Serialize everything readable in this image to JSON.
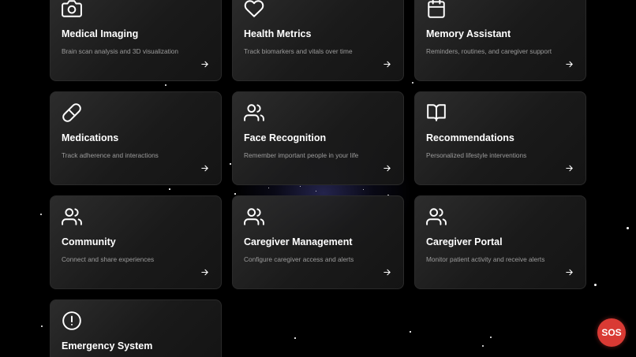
{
  "cards": [
    {
      "title": "Medical Imaging",
      "desc": "Brain scan analysis and 3D visualization",
      "icon": "camera-icon"
    },
    {
      "title": "Health Metrics",
      "desc": "Track biomarkers and vitals over time",
      "icon": "heart-icon"
    },
    {
      "title": "Memory Assistant",
      "desc": "Reminders, routines, and caregiver support",
      "icon": "calendar-icon"
    },
    {
      "title": "Medications",
      "desc": "Track adherence and interactions",
      "icon": "pill-icon"
    },
    {
      "title": "Face Recognition",
      "desc": "Remember important people in your life",
      "icon": "users-icon"
    },
    {
      "title": "Recommendations",
      "desc": "Personalized lifestyle interventions",
      "icon": "book-open-icon"
    },
    {
      "title": "Community",
      "desc": "Connect and share experiences",
      "icon": "users-icon"
    },
    {
      "title": "Caregiver Management",
      "desc": "Configure caregiver access and alerts",
      "icon": "users-icon"
    },
    {
      "title": "Caregiver Portal",
      "desc": "Monitor patient activity and receive alerts",
      "icon": "users-icon"
    },
    {
      "title": "Emergency System",
      "desc": "",
      "icon": "alert-circle-icon"
    }
  ],
  "sos": {
    "label": "SOS"
  },
  "colors": {
    "background": "#000000",
    "card": "#1f1f1f",
    "sos": "#d93a34",
    "description": "#9c9c9c"
  }
}
